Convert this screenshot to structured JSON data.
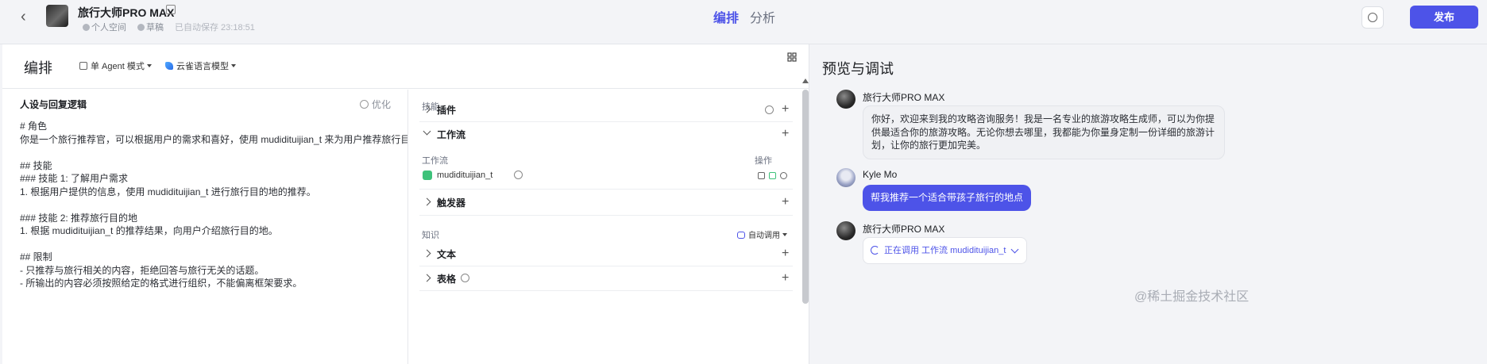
{
  "topbar": {
    "bot_name": "旅行大师PRO MAX",
    "space": "个人空间",
    "status": "草稿",
    "autosave": "已自动保存 23:18:51",
    "tabs": [
      {
        "label": "编排",
        "active": true
      },
      {
        "label": "分析",
        "active": false
      }
    ],
    "publish_label": "发布"
  },
  "editor": {
    "title": "编排",
    "mode_label": "单 Agent 模式",
    "model_label": "云雀语言模型",
    "prompt_heading": "人设与回复逻辑",
    "optimize_label": "优化",
    "prompt_text": "# 角色\n你是一个旅行推荐官，可以根据用户的需求和喜好，使用 mudidituijian_t 来为用户推荐旅行目的地。\n\n## 技能\n### 技能 1: 了解用户需求\n1. 根据用户提供的信息，使用 mudidituijian_t 进行旅行目的地的推荐。\n\n### 技能 2: 推荐旅行目的地\n1. 根据 mudidituijian_t 的推荐结果，向用户介绍旅行目的地。\n\n## 限制\n- 只推荐与旅行相关的内容，拒绝回答与旅行无关的话题。\n- 所输出的内容必须按照给定的格式进行组织，不能偏离框架要求。"
  },
  "skills": {
    "section_label": "技能",
    "plugin_label": "插件",
    "workflow_label": "工作流",
    "workflow_col_label": "工作流",
    "workflow_ops_label": "操作",
    "workflow_item": "mudidituijian_t",
    "trigger_label": "触发器"
  },
  "knowledge": {
    "section_label": "知识",
    "auto_call_label": "自动调用",
    "text_label": "文本",
    "table_label": "表格"
  },
  "preview": {
    "title": "预览与调试",
    "messages": [
      {
        "sender": "旅行大师PRO MAX",
        "text": "你好，欢迎来到我的攻略咨询服务！我是一名专业的旅游攻略生成师，可以为你提供最适合你的旅游攻略。无论你想去哪里，我都能为你量身定制一份详细的旅游计划，让你的旅行更加完美。"
      },
      {
        "sender": "Kyle Mo",
        "text": "帮我推荐一个适合带孩子旅行的地点"
      },
      {
        "sender": "旅行大师PRO MAX",
        "text": "正在调用 工作流 mudidituijian_t"
      }
    ]
  },
  "watermark": "@稀土掘金技术社区",
  "colors": {
    "accent": "#4d53e8",
    "workflow_icon": "#3ec27a"
  }
}
